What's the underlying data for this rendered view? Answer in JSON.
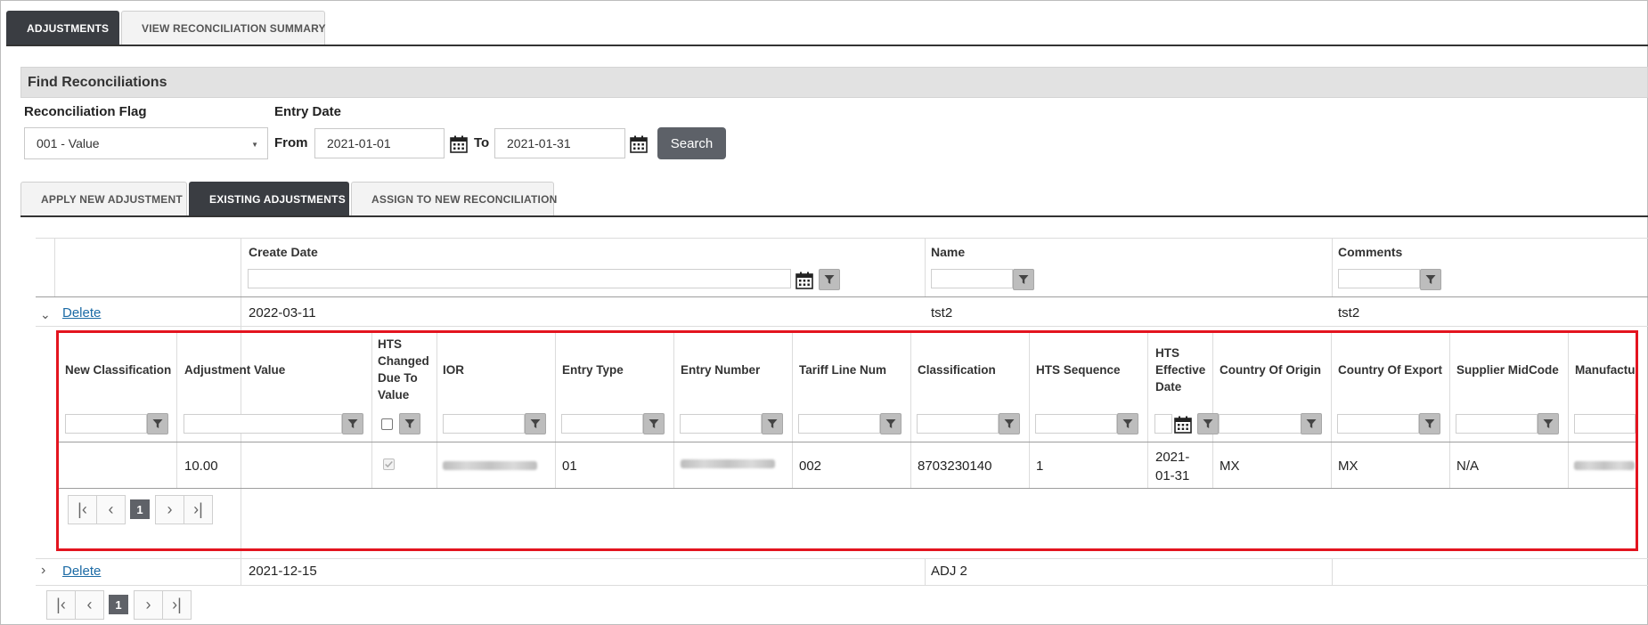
{
  "top_tabs": [
    "ADJUSTMENTS",
    "VIEW RECONCILIATION SUMMARY"
  ],
  "find": {
    "title": "Find Reconciliations",
    "flag_label": "Reconciliation Flag",
    "flag_value": "001 - Value",
    "entry_date_label": "Entry Date",
    "from_label": "From",
    "from_value": "2021-01-01",
    "to_label": "To",
    "to_value": "2021-01-31",
    "search_label": "Search"
  },
  "sub_tabs": [
    "APPLY NEW ADJUSTMENT",
    "EXISTING ADJUSTMENTS",
    "ASSIGN TO NEW RECONCILIATION"
  ],
  "grid": {
    "headers": [
      "Create Date",
      "Name",
      "Comments"
    ],
    "rows": [
      {
        "action": "Delete",
        "create_date": "2022-03-11",
        "name": "tst2",
        "comments": "tst2"
      },
      {
        "action": "Delete",
        "create_date": "2021-12-15",
        "name": "ADJ 2",
        "comments": ""
      }
    ],
    "page": "1"
  },
  "detail": {
    "headers": [
      "New Classification",
      "Adjustment Value",
      "HTS Changed Due To Value",
      "IOR",
      "Entry Type",
      "Entry Number",
      "Tariff Line Num",
      "Classification",
      "HTS Sequence",
      "HTS Effective Date",
      "Country Of Origin",
      "Country Of Export",
      "Supplier MidCode",
      "Manufactu"
    ],
    "row": {
      "new_classification": "",
      "adjustment_value": "10.00",
      "hts_changed": true,
      "entry_type": "01",
      "tariff_line_num": "002",
      "classification": "8703230140",
      "hts_sequence": "1",
      "hts_effective_date": "2021-01-31",
      "country_of_origin": "MX",
      "country_of_export": "MX",
      "supplier_midcode": "N/A"
    },
    "page": "1"
  }
}
